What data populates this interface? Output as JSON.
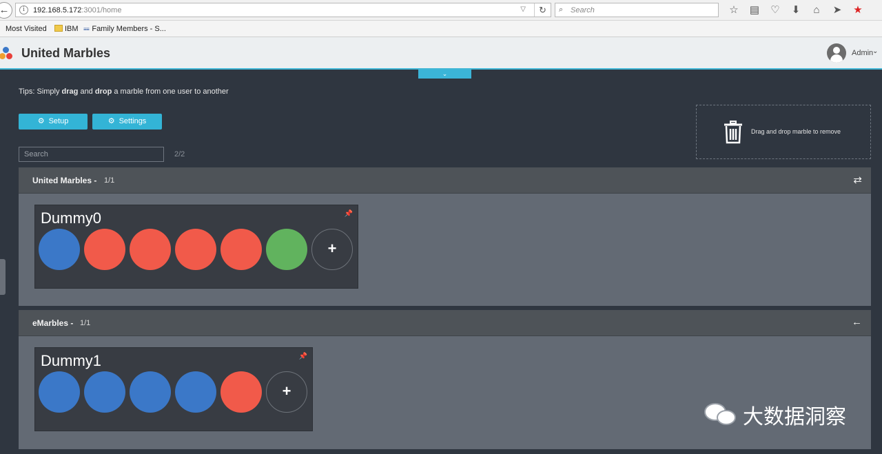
{
  "browser": {
    "url_host": "192.168.5.172",
    "url_path": ":3001/home",
    "search_placeholder": "Search",
    "bookmarks": [
      "Most Visited",
      "IBM",
      "Family Members - S..."
    ]
  },
  "header": {
    "title": "United Marbles",
    "user_label": "Admin"
  },
  "tips": {
    "prefix": "Tips: Simply ",
    "drag": "drag",
    "and": " and ",
    "drop": "drop",
    "suffix": " a marble from one user to another"
  },
  "buttons": {
    "setup": "Setup",
    "settings": "Settings"
  },
  "search": {
    "placeholder": "Search",
    "count": "2/2"
  },
  "trash": {
    "text": "Drag and drop marble to remove"
  },
  "colors": {
    "blue": "#3b78c8",
    "red": "#f15a4a",
    "green": "#61b35e",
    "accent": "#33b4d6"
  },
  "companies": [
    {
      "name": "United Marbles",
      "count": "1/1",
      "icon": "transfer-icon",
      "users": [
        {
          "name": "Dummy0",
          "marbles": [
            "blue",
            "red",
            "red",
            "red",
            "red",
            "green"
          ]
        }
      ]
    },
    {
      "name": "eMarbles",
      "count": "1/1",
      "icon": "arrow-left-icon",
      "users": [
        {
          "name": "Dummy1",
          "marbles": [
            "blue",
            "blue",
            "blue",
            "blue",
            "red"
          ]
        }
      ]
    }
  ],
  "watermark": "大数据洞察"
}
